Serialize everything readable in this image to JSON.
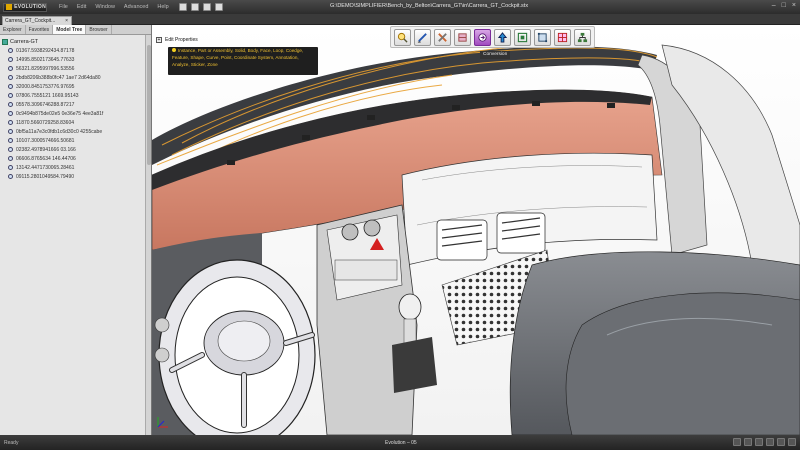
{
  "app": {
    "logo_text": "EVOLUTION",
    "menu": [
      "File",
      "Edit",
      "Window",
      "Advanced",
      "Help"
    ],
    "window_title": "G:\\DEMO\\SIMPLIFIER\\Bench_by_Belton\\Carrera_GT\\in\\Carrera_GT_Cockpit.stx",
    "controls": [
      "–",
      "□",
      "×"
    ]
  },
  "document_tab": {
    "label": "Carrera_GT_Cockpit...",
    "close": "×"
  },
  "panel": {
    "tabs": [
      "Explorer",
      "Favorites",
      "Model Tree",
      "Browser"
    ],
    "active_tab": "Model Tree",
    "root": "Carrera-GT",
    "items": [
      "01367.5938292434.87178",
      "14995.8502173645.77633",
      "56321.8295997996.53556",
      "2bdb8206b388b0fc47 1ae7 2d64da80",
      "32000.8451753776.97695",
      "07806.7555121 1669.95143",
      "05578.3096746288.87217",
      "0c9494b875de02e5 0e36e75 4ee3a81f",
      "11870.5660729258.83604",
      "0bf5a11a7e3c0fdb1c6d30c0 4255cabe",
      "10107.3000574666.50681",
      "02382.4978941666 03.166",
      "06606.8765634 146.44706",
      "13142.4471730065.28461",
      "09115.2801049584.79490"
    ]
  },
  "viewport": {
    "edit_properties": "Edit Properties",
    "filter_text": "Instance, Part or Assembly, Solid, Body, Face, Loop, Coedge, Feature, Shape, Curve, Point, Coordinate System, Annotation, Analyze, Sticker, Zone",
    "tooltip": "Conversion"
  },
  "toolbar": {
    "buttons": [
      {
        "name": "zoom-icon",
        "label": "Zoom"
      },
      {
        "name": "edit-icon",
        "label": "Edit"
      },
      {
        "name": "repair-icon",
        "label": "Repair"
      },
      {
        "name": "simplify-icon",
        "label": "Simplify"
      },
      {
        "name": "conversion-icon",
        "label": "Conversion",
        "active": true
      },
      {
        "name": "export-icon",
        "label": "Export"
      },
      {
        "name": "assembly-icon",
        "label": "Assembly"
      },
      {
        "name": "box-icon",
        "label": "Box"
      },
      {
        "name": "section-icon",
        "label": "Section"
      },
      {
        "name": "tree-icon",
        "label": "Tree"
      }
    ]
  },
  "status": {
    "left": "Ready",
    "center": "Evolution – 05"
  },
  "colors": {
    "accent": "#a04bbf",
    "titlebar": "#2c2c2c",
    "body_salmon": "#d98a73",
    "wireframe_orange": "#e8a030"
  }
}
